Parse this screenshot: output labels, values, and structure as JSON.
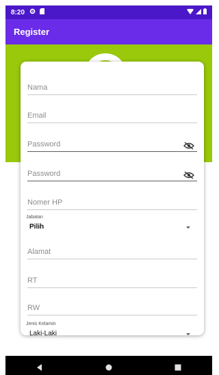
{
  "status_bar": {
    "time": "8:20",
    "icons": [
      "settings-icon",
      "sim-card-icon",
      "wifi-icon",
      "signal-icon",
      "battery-icon"
    ]
  },
  "app_bar": {
    "title": "Register"
  },
  "form": {
    "nama_placeholder": "Nama",
    "email_placeholder": "Email",
    "password_placeholder": "Password",
    "confirm_password_placeholder": "Password",
    "nomer_hp_placeholder": "Nomer HP",
    "jabatan_label": "Jabatan",
    "jabatan_value": "Pilih",
    "alamat_placeholder": "Alamat",
    "rt_placeholder": "RT",
    "rw_placeholder": "RW",
    "jenis_kelamin_label": "Jenis Kelamin",
    "jenis_kelamin_value": "Laki-Laki"
  },
  "colors": {
    "status_bar": "#4b18c9",
    "app_bar": "#6a2ce8",
    "green_band": "#99c90a",
    "nav_bar": "#000000"
  },
  "nav_icons": [
    "back-icon",
    "home-icon",
    "recents-icon"
  ]
}
